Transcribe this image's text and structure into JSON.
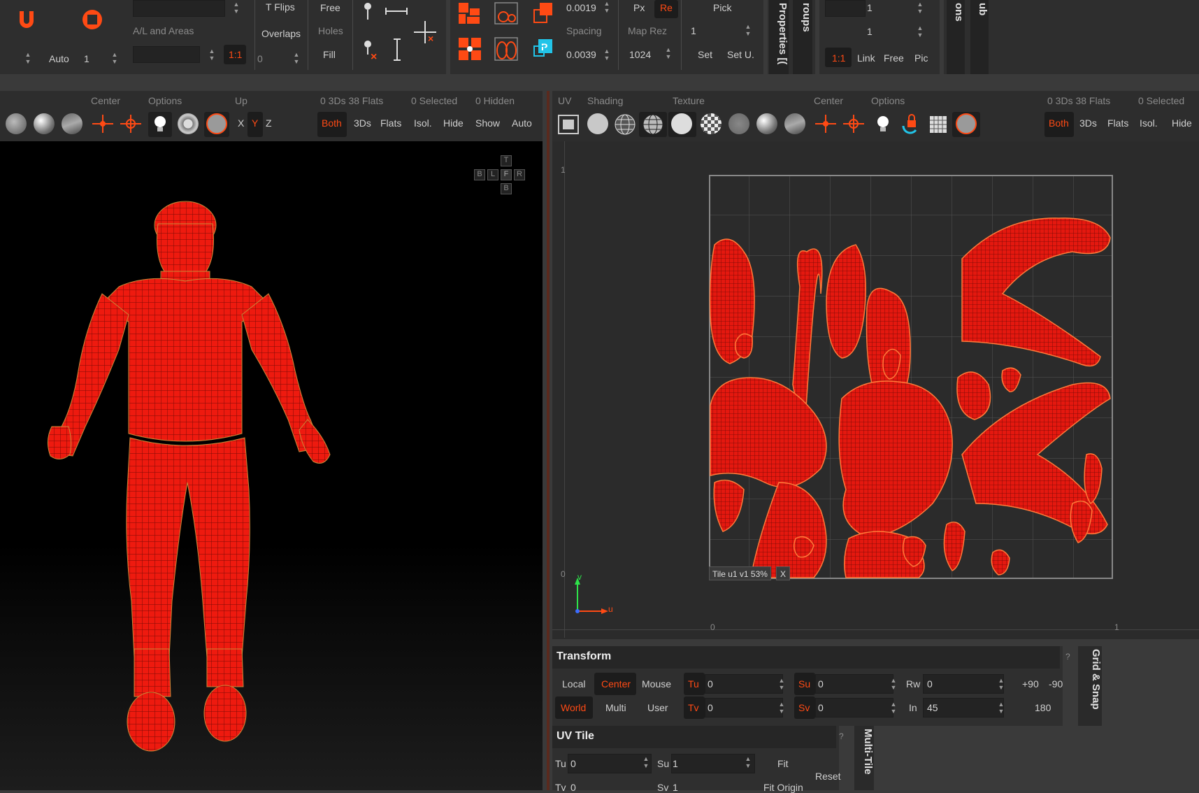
{
  "top_toolbar": {
    "col_al": {
      "label_al": "A/L and Areas",
      "auto_label": "Auto",
      "auto_value": "1",
      "ratio_btn": "1:1"
    },
    "col_flips": {
      "t_flips": "T Flips",
      "overlaps": "Overlaps",
      "free": "Free",
      "holes": "Holes",
      "fill": "Fill",
      "zero_value": "0"
    },
    "col_spacing": {
      "value1": "0.0019",
      "spacing_label": "Spacing",
      "value2": "0.0039",
      "px": "Px",
      "re": "Re",
      "map_rez_label": "Map Rez",
      "map_rez_value": "1024",
      "pick": "Pick",
      "pick_value": "1",
      "set": "Set",
      "set_u": "Set U."
    },
    "col_tabs": {
      "properties": "Properties [(",
      "groups": "roups",
      "ons": "ons",
      "ub": "ub"
    },
    "col_link": {
      "value1": "1",
      "value2": "1",
      "ratio": "1:1",
      "link": "Link",
      "free": "Free",
      "pic": "Pic"
    }
  },
  "left_view": {
    "labels": {
      "center": "Center",
      "options": "Options",
      "up": "Up",
      "stats": "0 3Ds 38 Flats",
      "selected": "0 Selected",
      "hidden": "0 Hidden"
    },
    "axes": {
      "x": "X",
      "y": "Y",
      "z": "Z"
    },
    "filters": {
      "both": "Both",
      "threeds": "3Ds",
      "flats": "Flats",
      "isol": "Isol.",
      "hide": "Hide",
      "show": "Show",
      "auto": "Auto"
    },
    "nav_cube": {
      "t": "T",
      "b": "B",
      "l": "L",
      "f": "F",
      "r": "R",
      "b2": "B"
    }
  },
  "uv_view": {
    "labels": {
      "uv": "UV",
      "shading": "Shading",
      "texture": "Texture",
      "center": "Center",
      "options": "Options",
      "stats": "0 3Ds 38 Flats",
      "selected": "0 Selected"
    },
    "filters": {
      "both": "Both",
      "threeds": "3Ds",
      "flats": "Flats",
      "isol": "Isol.",
      "hide": "Hide"
    },
    "ruler": {
      "v1": "1",
      "v0": "0",
      "u0": "0",
      "u1": "1"
    },
    "axis": {
      "v": "v",
      "u": "u"
    },
    "tile_label": "Tile u1 v1 53%",
    "tile_close": "X"
  },
  "transform": {
    "title": "Transform",
    "help": "?",
    "local": "Local",
    "center": "Center",
    "mouse": "Mouse",
    "world": "World",
    "multi": "Multi",
    "user": "User",
    "tu": "Tu",
    "tu_val": "0",
    "tv": "Tv",
    "tv_val": "0",
    "su": "Su",
    "su_val": "0",
    "sv": "Sv",
    "sv_val": "0",
    "rw": "Rw",
    "rw_val": "0",
    "in": "In",
    "in_val": "45",
    "p90": "+90",
    "m90": "-90",
    "r180": "180",
    "side_tab": "Grid & Snap"
  },
  "uv_tile": {
    "title": "UV Tile",
    "help": "?",
    "tu": "Tu",
    "tu_val": "0",
    "su": "Su",
    "su_val": "1",
    "tv": "Tv",
    "tv_val": "0",
    "sv": "Sv",
    "sv_val": "1",
    "fit": "Fit",
    "fit_origin": "Fit Origin",
    "reset": "Reset",
    "side_tab": "Multi-Tile"
  },
  "colors": {
    "accent": "#ff4a14",
    "mesh": "#e8180f",
    "panel": "#2b2b2b",
    "viewport": "#000000"
  }
}
